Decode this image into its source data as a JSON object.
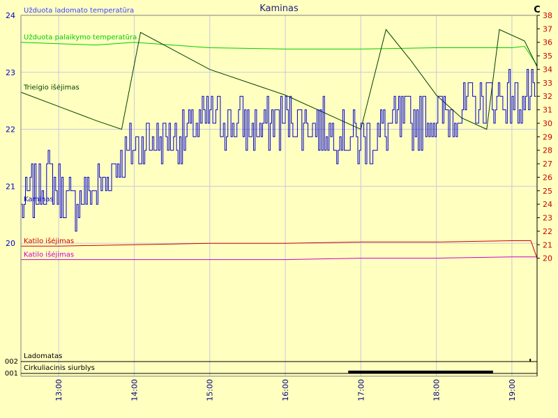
{
  "chart_data": {
    "type": "line",
    "title": "Kaminas",
    "right_unit": "C",
    "left_axis": {
      "range": [
        19.5,
        24
      ],
      "ticks": [
        20,
        21,
        22,
        23,
        24
      ],
      "color": "#0000cc"
    },
    "right_axis": {
      "range": [
        19,
        38
      ],
      "ticks": [
        20,
        21,
        22,
        23,
        24,
        25,
        26,
        27,
        28,
        29,
        30,
        31,
        32,
        33,
        34,
        35,
        36,
        37,
        38
      ],
      "color": "#cc0000"
    },
    "x_axis": {
      "start": "12:30",
      "end": "19:20",
      "ticks": [
        "13:00",
        "14:00",
        "15:00",
        "16:00",
        "17:00",
        "18:00",
        "19:00"
      ]
    },
    "grid": true,
    "series": [
      {
        "name": "Užduota ladomato temperatūra",
        "color": "#4040ff",
        "axis": "left",
        "x": [
          "12:30",
          "19:20"
        ],
        "y": [
          24.0,
          24.0
        ]
      },
      {
        "name": "Užduota palaikymo temperatūra",
        "color": "#00cc00",
        "axis": "right",
        "x": [
          "12:30",
          "13:00",
          "13:30",
          "14:00",
          "14:30",
          "15:00",
          "16:00",
          "17:00",
          "18:00",
          "19:00",
          "19:10",
          "19:20"
        ],
        "y": [
          36.0,
          35.9,
          35.8,
          36.0,
          35.8,
          35.6,
          35.5,
          35.5,
          35.6,
          35.6,
          35.7,
          34.3
        ]
      },
      {
        "name": "Trieigio išėjimas",
        "color": "#004000",
        "axis": "left",
        "x": [
          "12:30",
          "13:00",
          "13:30",
          "13:50",
          "14:05",
          "15:00",
          "16:00",
          "16:45",
          "17:00",
          "17:20",
          "17:40",
          "18:00",
          "18:20",
          "18:40",
          "18:50",
          "19:10",
          "19:20"
        ],
        "y": [
          22.65,
          22.4,
          22.15,
          22.0,
          23.7,
          23.05,
          22.6,
          22.15,
          22.0,
          23.75,
          23.2,
          22.6,
          22.2,
          22.0,
          23.75,
          23.55,
          23.1
        ]
      },
      {
        "name": "Kaminas",
        "color": "#0000cc",
        "axis": "right",
        "noisy": true,
        "x": [
          "12:30",
          "12:50",
          "13:10",
          "13:30",
          "13:50",
          "14:00",
          "14:40",
          "15:00",
          "15:40",
          "16:00",
          "16:40",
          "17:00",
          "17:30",
          "18:00",
          "18:30",
          "19:00",
          "19:20"
        ],
        "y": [
          24.0,
          26.0,
          24.0,
          25.0,
          27.5,
          28.5,
          29.0,
          30.5,
          29.5,
          30.5,
          29.5,
          28.5,
          30.0,
          30.5,
          31.5,
          32.0,
          31.5
        ]
      },
      {
        "name": "Katilo išėjimas",
        "color": "#cc0000",
        "axis": "right",
        "x": [
          "12:30",
          "13:00",
          "14:00",
          "15:00",
          "16:00",
          "17:00",
          "18:00",
          "19:00",
          "19:15",
          "19:20"
        ],
        "y": [
          20.9,
          20.9,
          21.0,
          21.1,
          21.1,
          21.2,
          21.2,
          21.3,
          21.3,
          20.0
        ]
      },
      {
        "name": "Katilo išėjimas",
        "color": "#cc00cc",
        "axis": "right",
        "x": [
          "12:30",
          "14:00",
          "15:00",
          "16:00",
          "17:00",
          "18:00",
          "19:00",
          "19:15",
          "19:20"
        ],
        "y": [
          19.9,
          19.9,
          19.9,
          19.9,
          20.0,
          20.0,
          20.1,
          20.1,
          20.1
        ]
      }
    ],
    "digital": [
      {
        "name": "Ladomatas",
        "code": "002",
        "on": [
          [
            "19:14",
            "19:15"
          ]
        ]
      },
      {
        "name": "Cirkuliacinis siurblys",
        "code": "001",
        "on": [
          [
            "16:50",
            "18:45"
          ]
        ]
      }
    ]
  }
}
